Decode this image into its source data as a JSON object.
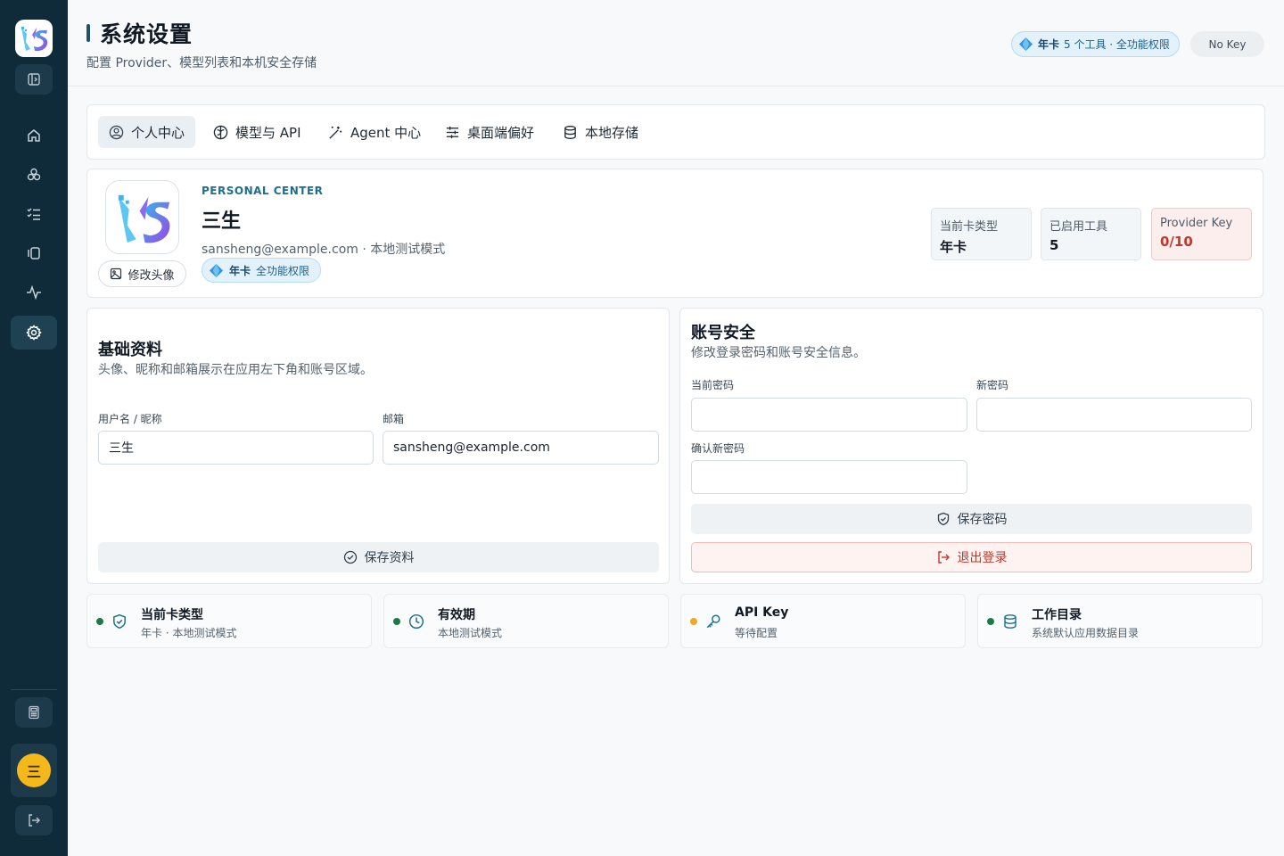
{
  "app": {
    "page_title": "系统设置",
    "page_subtitle": "配置 Provider、模型列表和本机安全存储"
  },
  "header": {
    "plan_label": "年卡",
    "plan_detail": "5 个工具 · 全功能权限",
    "key_status": "No Key"
  },
  "sidebar": {
    "items": [
      {
        "icon": "home-icon"
      },
      {
        "icon": "apps-icon"
      },
      {
        "icon": "checklist-icon"
      },
      {
        "icon": "cards-icon"
      },
      {
        "icon": "activity-icon"
      },
      {
        "icon": "gear-icon",
        "active": true
      }
    ],
    "avatar_initial": "三"
  },
  "tabs": [
    {
      "label": "个人中心",
      "icon": "user-circle-icon",
      "active": true
    },
    {
      "label": "模型与 API",
      "icon": "brain-icon"
    },
    {
      "label": "Agent 中心",
      "icon": "magic-wand-icon"
    },
    {
      "label": "桌面端偏好",
      "icon": "sliders-icon"
    },
    {
      "label": "本地存储",
      "icon": "database-icon"
    }
  ],
  "profile": {
    "eyebrow": "PERSONAL CENTER",
    "name": "三生",
    "meta": "sansheng@example.com · 本地测试模式",
    "badge_label": "年卡",
    "badge_detail": "全功能权限",
    "change_avatar": "修改头像",
    "stats": [
      {
        "label": "当前卡类型",
        "value": "年卡"
      },
      {
        "label": "已启用工具",
        "value": "5"
      },
      {
        "label": "Provider Key",
        "value": "0/10"
      }
    ]
  },
  "basic": {
    "title": "基础资料",
    "desc": "头像、昵称和邮箱展示在应用左下角和账号区域。",
    "username_label": "用户名 / 昵称",
    "username_value": "三生",
    "email_label": "邮箱",
    "email_value": "sansheng@example.com",
    "save_label": "保存资料"
  },
  "security": {
    "title": "账号安全",
    "desc": "修改登录密码和账号安全信息。",
    "current_label": "当前密码",
    "new_label": "新密码",
    "confirm_label": "确认新密码",
    "save_label": "保存密码",
    "logout_label": "退出登录"
  },
  "status": [
    {
      "title": "当前卡类型",
      "sub": "年卡 · 本地测试模式",
      "dot": "#1e7a45",
      "icon": "shield-check-icon"
    },
    {
      "title": "有效期",
      "sub": "本地测试模式",
      "dot": "#1e7a45",
      "icon": "clock-icon"
    },
    {
      "title": "API Key",
      "sub": "等待配置",
      "dot": "#f0a91c",
      "icon": "key-icon"
    },
    {
      "title": "工作目录",
      "sub": "系统默认应用数据目录",
      "dot": "#1e7a45",
      "icon": "database-icon"
    }
  ],
  "colors": {
    "sidebar_bg": "#0f2a38",
    "accent": "#1b6f8f",
    "danger": "#c0392b",
    "avatar_bg": "#f5b81a"
  }
}
